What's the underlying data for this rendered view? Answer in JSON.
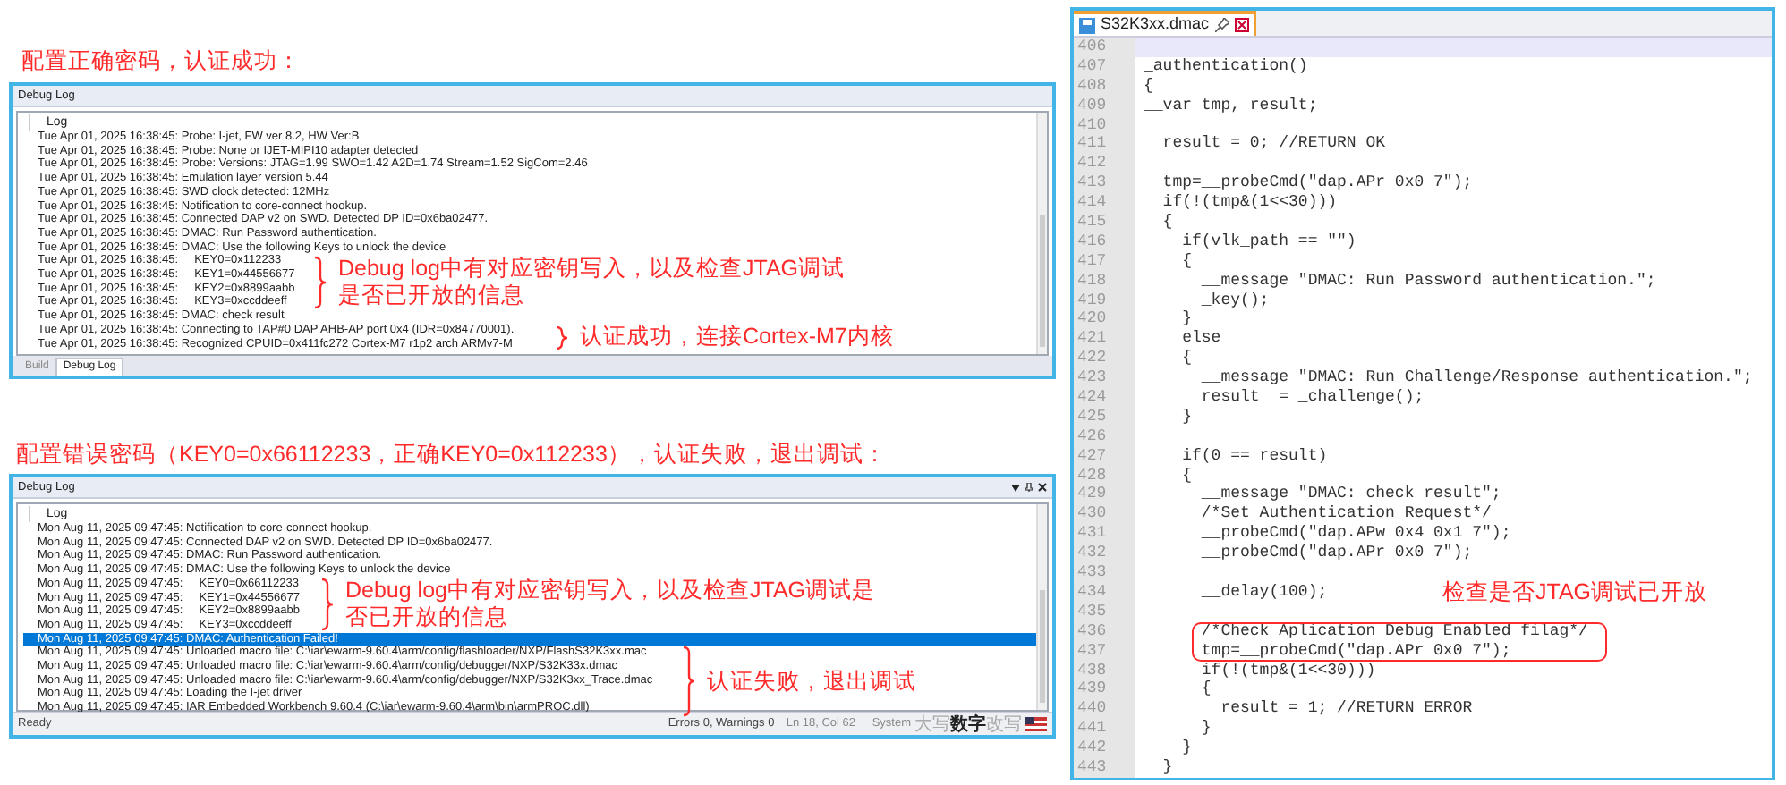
{
  "top_caption": "配置正确密码，认证成功：",
  "top_panel": {
    "title": "Debug Log",
    "column_header": "Log",
    "lines": [
      {
        "text": "Tue Apr 01, 2025 16:38:45: Probe: I-jet, FW ver 8.2, HW Ver:B",
        "selected": false
      },
      {
        "text": "Tue Apr 01, 2025 16:38:45: Probe: None or IJET-MIPI10 adapter detected",
        "selected": false
      },
      {
        "text": "Tue Apr 01, 2025 16:38:45: Probe: Versions: JTAG=1.99 SWO=1.42 A2D=1.74 Stream=1.52 SigCom=2.46",
        "selected": false
      },
      {
        "text": "Tue Apr 01, 2025 16:38:45: Emulation layer version 5.44",
        "selected": false
      },
      {
        "text": "Tue Apr 01, 2025 16:38:45: SWD clock detected: 12MHz",
        "selected": false
      },
      {
        "text": "Tue Apr 01, 2025 16:38:45: Notification to core-connect hookup.",
        "selected": false
      },
      {
        "text": "Tue Apr 01, 2025 16:38:45: Connected DAP v2 on SWD. Detected DP ID=0x6ba02477.",
        "selected": false
      },
      {
        "text": "Tue Apr 01, 2025 16:38:45: DMAC: Run Password authentication.",
        "selected": false
      },
      {
        "text": "Tue Apr 01, 2025 16:38:45: DMAC: Use the following Keys to unlock the device",
        "selected": false
      },
      {
        "text": "Tue Apr 01, 2025 16:38:45:     KEY0=0x112233",
        "selected": false
      },
      {
        "text": "Tue Apr 01, 2025 16:38:45:     KEY1=0x44556677",
        "selected": false
      },
      {
        "text": "Tue Apr 01, 2025 16:38:45:     KEY2=0x8899aabb",
        "selected": false
      },
      {
        "text": "Tue Apr 01, 2025 16:38:45:     KEY3=0xccddeeff",
        "selected": false
      },
      {
        "text": "Tue Apr 01, 2025 16:38:45: DMAC: check result",
        "selected": false
      },
      {
        "text": "Tue Apr 01, 2025 16:38:45: Connecting to TAP#0 DAP AHB-AP port 0x4 (IDR=0x84770001).",
        "selected": false
      },
      {
        "text": "Tue Apr 01, 2025 16:38:45: Recognized CPUID=0x411fc272 Cortex-M7 r1p2 arch ARMv7-M",
        "selected": false
      }
    ],
    "annotations": [
      {
        "lines": [
          "Debug log中有对应密钥写入，以及检查JTAG调试",
          "是否已开放的信息"
        ]
      },
      {
        "lines": [
          "认证成功，连接Cortex-M7内核"
        ]
      }
    ],
    "tabs": [
      {
        "label": "Build",
        "selected": false
      },
      {
        "label": "Debug Log",
        "selected": true
      }
    ]
  },
  "bottom_caption": "配置错误密码（KEY0=0x66112233，正确KEY0=0x112233），认证失败，退出调试：",
  "bottom_panel": {
    "title": "Debug Log",
    "column_header": "Log",
    "lines": [
      {
        "text": "Mon Aug 11, 2025 09:47:45: Notification to core-connect hookup.",
        "selected": false
      },
      {
        "text": "Mon Aug 11, 2025 09:47:45: Connected DAP v2 on SWD. Detected DP ID=0x6ba02477.",
        "selected": false
      },
      {
        "text": "Mon Aug 11, 2025 09:47:45: DMAC: Run Password authentication.",
        "selected": false
      },
      {
        "text": "Mon Aug 11, 2025 09:47:45: DMAC: Use the following Keys to unlock the device",
        "selected": false
      },
      {
        "text": "Mon Aug 11, 2025 09:47:45:     KEY0=0x66112233",
        "selected": false
      },
      {
        "text": "Mon Aug 11, 2025 09:47:45:     KEY1=0x44556677",
        "selected": false
      },
      {
        "text": "Mon Aug 11, 2025 09:47:45:     KEY2=0x8899aabb",
        "selected": false
      },
      {
        "text": "Mon Aug 11, 2025 09:47:45:     KEY3=0xccddeeff",
        "selected": false
      },
      {
        "text": "Mon Aug 11, 2025 09:47:45: DMAC: Authentication Failed!",
        "selected": true
      },
      {
        "text": "Mon Aug 11, 2025 09:47:45: Unloaded macro file: C:\\iar\\ewarm-9.60.4\\arm/config/flashloader/NXP/FlashS32K3xx.mac",
        "selected": false
      },
      {
        "text": "Mon Aug 11, 2025 09:47:45: Unloaded macro file: C:\\iar\\ewarm-9.60.4\\arm/config/debugger/NXP/S32K33x.dmac",
        "selected": false
      },
      {
        "text": "Mon Aug 11, 2025 09:47:45: Unloaded macro file: C:\\iar\\ewarm-9.60.4\\arm/config/debugger/NXP/S32K3xx_Trace.dmac",
        "selected": false
      },
      {
        "text": "Mon Aug 11, 2025 09:47:45: Loading the I-jet driver",
        "selected": false
      },
      {
        "text": "Mon Aug 11, 2025 09:47:45: IAR Embedded Workbench 9.60.4 (C:\\iar\\ewarm-9.60.4\\arm\\bin\\armPROC.dll)",
        "selected": false
      }
    ],
    "annotations": [
      {
        "lines": [
          "Debug log中有对应密钥写入，以及检查JTAG调试是",
          "否已开放的信息"
        ]
      },
      {
        "lines": [
          "认证失败，退出调试"
        ]
      }
    ],
    "status_bar": {
      "left": "Ready",
      "errors": "Errors 0, Warnings 0",
      "position": "Ln 18, Col 62",
      "mode": "System",
      "indicators": [
        {
          "label": "大写",
          "on": false
        },
        {
          "label": "数字",
          "on": true
        },
        {
          "label": "改写",
          "on": false
        }
      ]
    }
  },
  "editor": {
    "tab": "S32K3xx.dmac",
    "annotation": "检查是否JTAG调试已开放",
    "lines": [
      {
        "number": "406",
        "current": true,
        "boxed": false
      },
      {
        "number": "407",
        "text": "_authentication()",
        "current": false,
        "boxed": false
      },
      {
        "number": "408",
        "text": "{",
        "current": false,
        "boxed": false
      },
      {
        "number": "409",
        "text": "__var tmp, result;",
        "current": false,
        "boxed": false
      },
      {
        "number": "410",
        "current": false,
        "boxed": false
      },
      {
        "number": "411",
        "text": "  result = 0; //RETURN_OK",
        "current": false,
        "boxed": false
      },
      {
        "number": "412",
        "current": false,
        "boxed": false
      },
      {
        "number": "413",
        "text": "  tmp=__probeCmd(\"dap.APr 0x0 7\");",
        "current": false,
        "boxed": false
      },
      {
        "number": "414",
        "text": "  if(!(tmp&(1<<30)))",
        "current": false,
        "boxed": false
      },
      {
        "number": "415",
        "text": "  {",
        "current": false,
        "boxed": false
      },
      {
        "number": "416",
        "text": "    if(vlk_path == \"\")",
        "current": false,
        "boxed": false
      },
      {
        "number": "417",
        "text": "    {",
        "current": false,
        "boxed": false
      },
      {
        "number": "418",
        "text": "      __message \"DMAC: Run Password authentication.\";",
        "current": false,
        "boxed": false
      },
      {
        "number": "419",
        "text": "      _key();",
        "current": false,
        "boxed": false
      },
      {
        "number": "420",
        "text": "    }",
        "current": false,
        "boxed": false
      },
      {
        "number": "421",
        "text": "    else",
        "current": false,
        "boxed": false
      },
      {
        "number": "422",
        "text": "    {",
        "current": false,
        "boxed": false
      },
      {
        "number": "423",
        "text": "      __message \"DMAC: Run Challenge/Response authentication.\";",
        "current": false,
        "boxed": false
      },
      {
        "number": "424",
        "text": "      result  = _challenge();",
        "current": false,
        "boxed": false
      },
      {
        "number": "425",
        "text": "    }",
        "current": false,
        "boxed": false
      },
      {
        "number": "426",
        "current": false,
        "boxed": false
      },
      {
        "number": "427",
        "text": "    if(0 == result)",
        "current": false,
        "boxed": false
      },
      {
        "number": "428",
        "text": "    {",
        "current": false,
        "boxed": false
      },
      {
        "number": "429",
        "text": "      __message \"DMAC: check result\";",
        "current": false,
        "boxed": false
      },
      {
        "number": "430",
        "text": "      /*Set Authentication Request*/",
        "current": false,
        "boxed": false
      },
      {
        "number": "431",
        "text": "      __probeCmd(\"dap.APw 0x4 0x1 7\");",
        "current": false,
        "boxed": false
      },
      {
        "number": "432",
        "text": "      __probeCmd(\"dap.APr 0x0 7\");",
        "current": false,
        "boxed": false
      },
      {
        "number": "433",
        "current": false,
        "boxed": false
      },
      {
        "number": "434",
        "text": "      __delay(100);",
        "current": false,
        "boxed": false
      },
      {
        "number": "435",
        "current": false,
        "boxed": false
      },
      {
        "number": "436",
        "text": "      /*Check Aplication Debug Enabled filag*/",
        "current": false,
        "boxed": true
      },
      {
        "number": "437",
        "text": "      tmp=__probeCmd(\"dap.APr 0x0 7\");",
        "current": false,
        "boxed": true
      },
      {
        "number": "438",
        "text": "      if(!(tmp&(1<<30)))",
        "current": false,
        "boxed": false
      },
      {
        "number": "439",
        "text": "      {",
        "current": false,
        "boxed": false
      },
      {
        "number": "440",
        "text": "        result = 1; //RETURN_ERROR",
        "current": false,
        "boxed": false
      },
      {
        "number": "441",
        "text": "      }",
        "current": false,
        "boxed": false
      },
      {
        "number": "442",
        "text": "    }",
        "current": false,
        "boxed": false
      },
      {
        "number": "443",
        "text": "  }",
        "current": false,
        "boxed": false
      }
    ]
  }
}
